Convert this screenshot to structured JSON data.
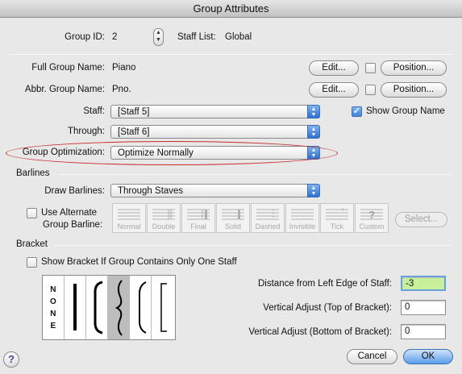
{
  "window": {
    "title": "Group Attributes"
  },
  "group_id": {
    "label": "Group ID:",
    "value": "2"
  },
  "staff_list": {
    "label": "Staff List:",
    "value": "Global"
  },
  "full_name": {
    "label": "Full Group Name:",
    "value": "Piano",
    "edit": "Edit...",
    "position": "Position..."
  },
  "abbr_name": {
    "label": "Abbr. Group Name:",
    "value": "Pno.",
    "edit": "Edit...",
    "position": "Position..."
  },
  "staff": {
    "label": "Staff:",
    "value": "[Staff 5]"
  },
  "through": {
    "label": "Through:",
    "value": "[Staff 6]"
  },
  "show_group_name": {
    "label": "Show Group Name",
    "checked": true
  },
  "optimization": {
    "label": "Group Optimization:",
    "value": "Optimize Normally"
  },
  "barlines": {
    "section": "Barlines",
    "draw_label": "Draw Barlines:",
    "draw_value": "Through Staves",
    "alt_label_1": "Use Alternate",
    "alt_label_2": "Group Barline:",
    "styles": [
      "Normal",
      "Double",
      "Final",
      "Solid",
      "Dashed",
      "Invisible",
      "Tick",
      "Custom"
    ],
    "select": "Select..."
  },
  "bracket": {
    "section": "Bracket",
    "only_one_label": "Show Bracket If Group Contains Only One Staff",
    "none_letters": [
      "N",
      "O",
      "N",
      "E"
    ],
    "distance_label": "Distance from Left Edge of Staff:",
    "distance_value": "-3",
    "top_label": "Vertical Adjust (Top of Bracket):",
    "top_value": "0",
    "bottom_label": "Vertical Adjust (Bottom of Bracket):",
    "bottom_value": "0"
  },
  "buttons": {
    "cancel": "Cancel",
    "ok": "OK",
    "help": "?"
  },
  "colors": {
    "accent": "#3f86d8",
    "highlight_field": "#c8f09a",
    "annotation": "#c82a2a"
  }
}
